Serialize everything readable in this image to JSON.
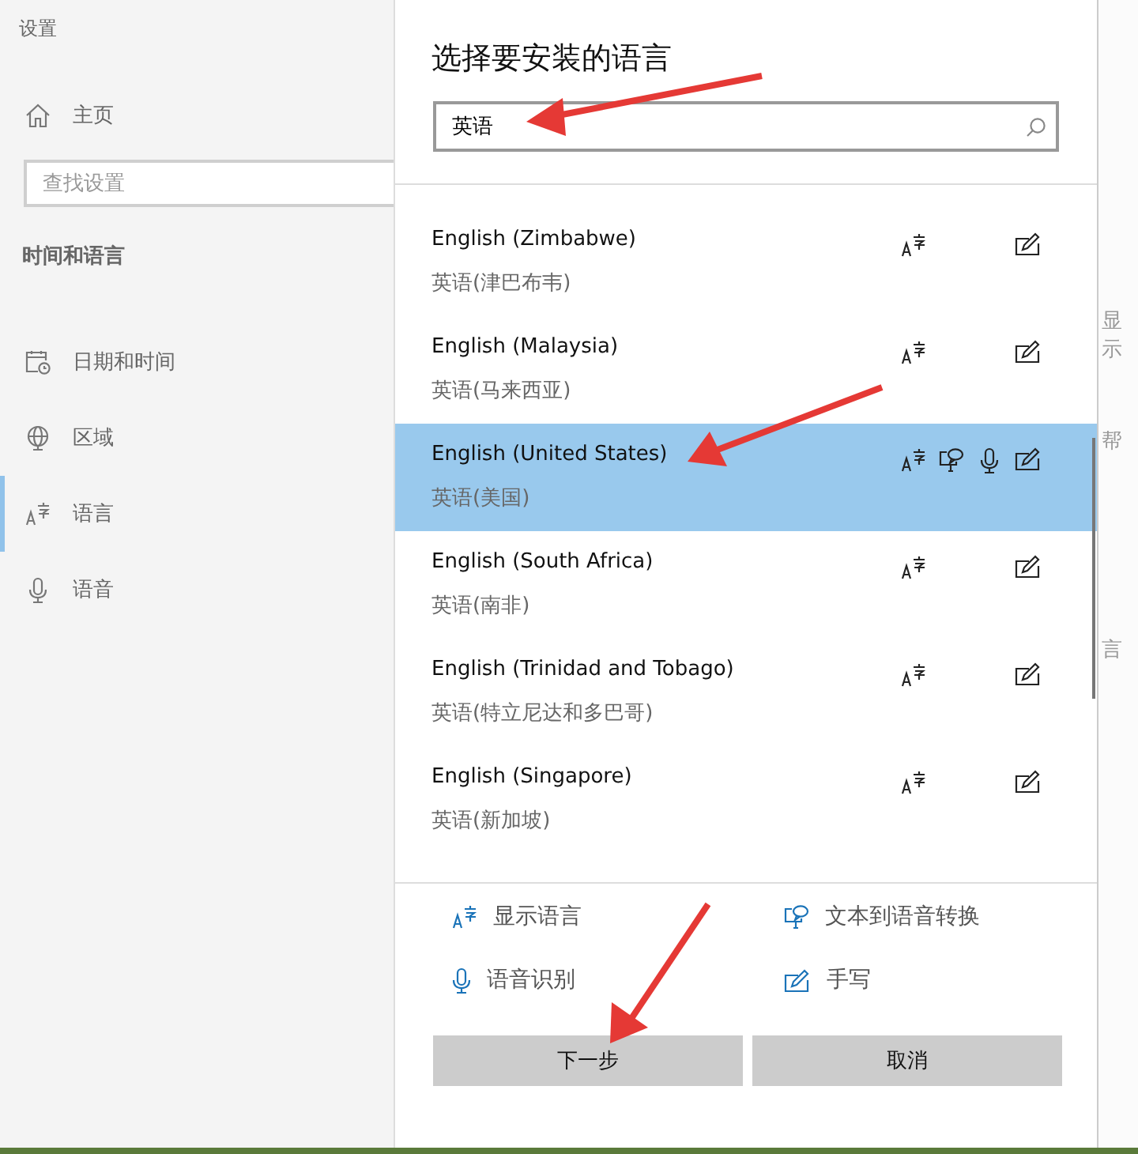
{
  "sidebar": {
    "title": "设置",
    "home": "主页",
    "search": {
      "placeholder": "查找设置"
    },
    "section": "时间和语言",
    "items": [
      {
        "label": "日期和时间",
        "selected": false
      },
      {
        "label": "区域",
        "selected": false
      },
      {
        "label": "语言",
        "selected": true
      },
      {
        "label": "语音",
        "selected": false
      }
    ]
  },
  "dialog": {
    "title": "选择要安装的语言",
    "search": {
      "value": "英语"
    },
    "languages": [
      {
        "name": "English (Zimbabwe)",
        "native": "英语(津巴布韦)",
        "display_language": true,
        "text_to_speech": false,
        "speech_recognition": false,
        "handwriting": true,
        "selected": false
      },
      {
        "name": "English (Malaysia)",
        "native": "英语(马来西亚)",
        "display_language": true,
        "text_to_speech": false,
        "speech_recognition": false,
        "handwriting": true,
        "selected": false
      },
      {
        "name": "English (United States)",
        "native": "英语(美国)",
        "display_language": true,
        "text_to_speech": true,
        "speech_recognition": true,
        "handwriting": true,
        "selected": true
      },
      {
        "name": "English (South Africa)",
        "native": "英语(南非)",
        "display_language": true,
        "text_to_speech": false,
        "speech_recognition": false,
        "handwriting": true,
        "selected": false
      },
      {
        "name": "English (Trinidad and Tobago)",
        "native": "英语(特立尼达和多巴哥)",
        "display_language": true,
        "text_to_speech": false,
        "speech_recognition": false,
        "handwriting": true,
        "selected": false
      },
      {
        "name": "English (Singapore)",
        "native": "英语(新加坡)",
        "display_language": true,
        "text_to_speech": false,
        "speech_recognition": false,
        "handwriting": true,
        "selected": false
      }
    ],
    "legend": [
      {
        "kind": "display",
        "label": "显示语言"
      },
      {
        "kind": "tts",
        "label": "文本到语音转换"
      },
      {
        "kind": "speech",
        "label": "语音识别"
      },
      {
        "kind": "handwriting",
        "label": "手写"
      }
    ],
    "buttons": [
      {
        "label": "下一步"
      },
      {
        "label": "取消"
      }
    ]
  },
  "background_page": {
    "texts": [
      "显示",
      "帮",
      "言"
    ]
  }
}
